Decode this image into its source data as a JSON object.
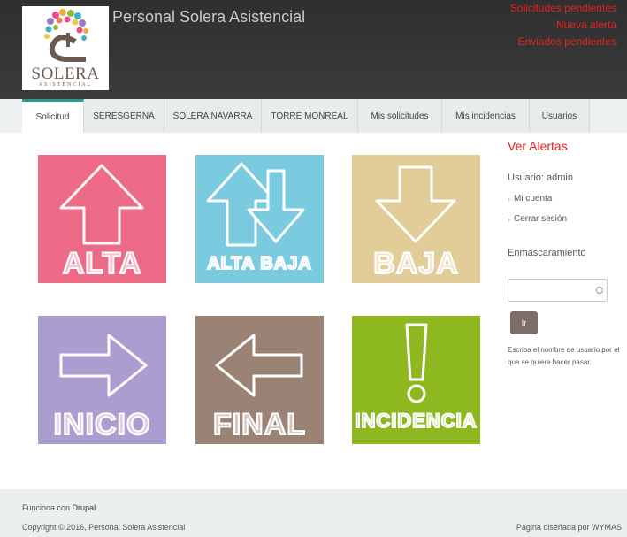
{
  "header": {
    "site_name": "Personal Solera Asistencial",
    "logo_word": "SOLERA",
    "logo_sub": "ASISTENCIAL",
    "alerts": [
      "Solicitudes pendientes",
      "Nueva alerta",
      "Enviados pendientes"
    ]
  },
  "nav": {
    "tabs": [
      {
        "label": "Solicitud",
        "active": true
      },
      {
        "label": "SERESGERNA"
      },
      {
        "label": "SOLERA NAVARRA"
      },
      {
        "label": "TORRE MONREAL"
      },
      {
        "label": "Mis solicitudes"
      },
      {
        "label": "Mis incidencias"
      },
      {
        "label": "Usuarios"
      }
    ]
  },
  "tiles": [
    {
      "label": "ALTA",
      "color": "#ee6b87",
      "icon": "arrow-up-icon"
    },
    {
      "label": "ALTA BAJA",
      "color": "#7bcbe0",
      "icon": "arrow-up-down-icon"
    },
    {
      "label": "BAJA",
      "color": "#e2cc97",
      "icon": "arrow-down-icon"
    },
    {
      "label": "INICIO",
      "color": "#ab9dcf",
      "icon": "arrow-right-icon"
    },
    {
      "label": "FINAL",
      "color": "#9a8274",
      "icon": "arrow-left-icon"
    },
    {
      "label": "INCIDENCIA",
      "color": "#8db81f",
      "icon": "exclamation-icon"
    }
  ],
  "sidebar": {
    "title": "Ver Alertas",
    "user": "Usuario: admin",
    "links": [
      "Mi cuenta",
      "Cerrar sesión"
    ],
    "mask_label": "Enmascaramiento",
    "input_value": "",
    "button_label": "Ir",
    "help": "Escriba el nombre de usuario por el que se quiere hacer pasar."
  },
  "footer": {
    "powered_prefix": "Funciona con",
    "powered_link": "Drupal",
    "copyright": "Copyright © 2016, Personal Solera Asistencial",
    "design_prefix": "Página diseñada por",
    "design_link": "WYMAS"
  },
  "colors": {
    "accent": "#2a9d8f",
    "alert": "#e8211e",
    "header_bg": "#333333"
  }
}
